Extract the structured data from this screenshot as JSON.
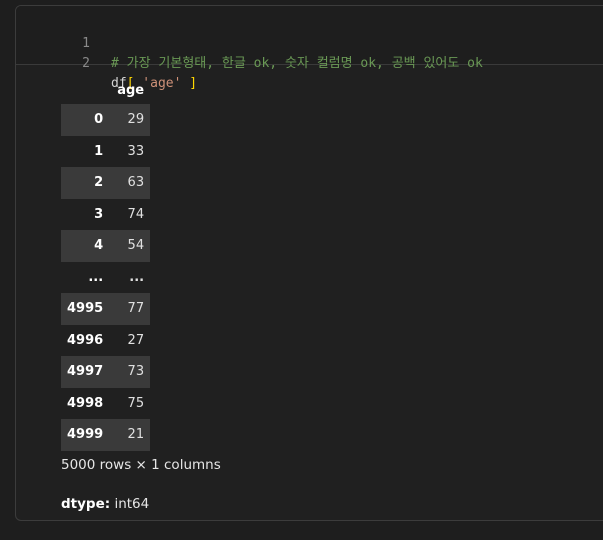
{
  "code": {
    "lines": [
      {
        "number": "1",
        "comment": "# 가장 기본형태, 한글 ok, 숫자 컬럼명 ok, 공백 있어도 ok"
      },
      {
        "number": "2",
        "prefix": "df",
        "open_bracket": "[",
        "string": " 'age' ",
        "close_bracket": "]"
      }
    ]
  },
  "dataframe": {
    "column_header": "age",
    "rows": [
      {
        "index": "0",
        "value": "29"
      },
      {
        "index": "1",
        "value": "33"
      },
      {
        "index": "2",
        "value": "63"
      },
      {
        "index": "3",
        "value": "74"
      },
      {
        "index": "4",
        "value": "54"
      },
      {
        "index": "...",
        "value": "..."
      },
      {
        "index": "4995",
        "value": "77"
      },
      {
        "index": "4996",
        "value": "27"
      },
      {
        "index": "4997",
        "value": "73"
      },
      {
        "index": "4998",
        "value": "75"
      },
      {
        "index": "4999",
        "value": "21"
      }
    ],
    "shape_text": "5000 rows × 1 columns",
    "dtype_label": "dtype:",
    "dtype_value": "int64"
  },
  "colors": {
    "background": "#1e1e1e",
    "comment": "#6a9955",
    "bracket": "#ffd700",
    "string": "#ce9178",
    "shaded_row": "#3a3a3a"
  }
}
